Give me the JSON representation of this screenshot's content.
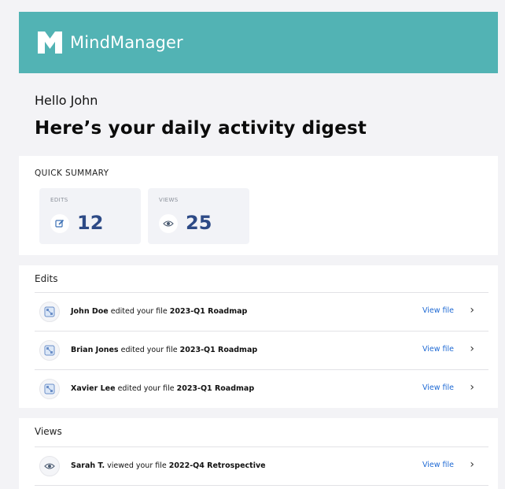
{
  "brand": {
    "name": "MindManager",
    "color": "#52b3b4"
  },
  "greeting": "Hello John",
  "headline": "Here’s your daily activity digest",
  "summary": {
    "title": "QUICK SUMMARY",
    "edits": {
      "label": "EDITS",
      "value": "12",
      "icon": "pencil-edit-icon"
    },
    "views": {
      "label": "VIEWS",
      "value": "25",
      "icon": "eye-icon"
    }
  },
  "edits_section": {
    "title": "Edits",
    "items": [
      {
        "user": "John Doe",
        "action": " edited your file ",
        "file": "2023-Q1 Roadmap",
        "link": "View file",
        "icon": "mindmap-file-icon"
      },
      {
        "user": "Brian Jones",
        "action": " edited your file ",
        "file": "2023-Q1 Roadmap",
        "link": "View file",
        "icon": "mindmap-file-icon"
      },
      {
        "user": "Xavier Lee",
        "action": " edited your file ",
        "file": "2023-Q1 Roadmap",
        "link": "View file",
        "icon": "mindmap-file-icon"
      }
    ]
  },
  "views_section": {
    "title": "Views",
    "items": [
      {
        "user": "Sarah T.",
        "action": " viewed your file ",
        "file": "2022-Q4 Retrospective",
        "link": "View file",
        "icon": "eye-icon"
      }
    ]
  },
  "colors": {
    "accent_link": "#1f6ad4",
    "stat_number": "#2d4a86"
  }
}
